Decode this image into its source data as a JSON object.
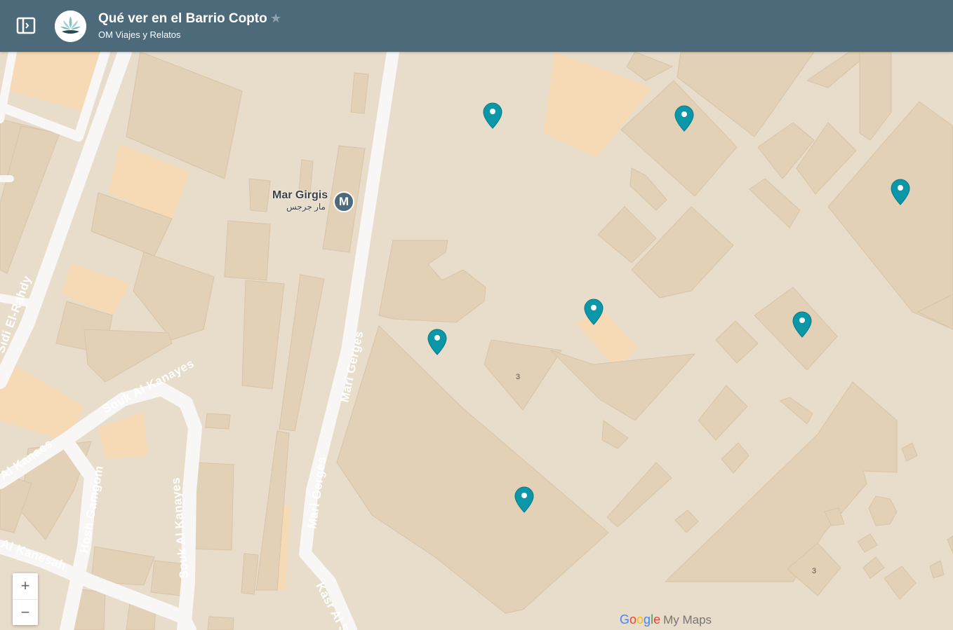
{
  "header": {
    "title": "Qué ver en el Barrio Copto",
    "subtitle": "OM Viajes y Relatos"
  },
  "map": {
    "station": {
      "name": "Mar Girgis",
      "arabic": "مار جرجس",
      "icon": "M"
    },
    "road_labels": [
      "Mari Gerges",
      "Mari Gerges",
      "Souk Al Kanayes",
      "Souk Al Kanayes",
      "Hosh Gamgom",
      "Al Kanaes",
      "Al Kanesah",
      "Sidi El-Rahdy",
      "Kasr Al Sham"
    ],
    "building_numbers": [
      "3",
      "3"
    ],
    "markers": [
      "location-pin-icon",
      "location-pin-icon",
      "location-pin-icon",
      "location-pin-icon",
      "location-pin-icon",
      "location-pin-icon",
      "location-pin-icon"
    ],
    "marker_color": "#0b97a8"
  },
  "controls": {
    "zoom_in": "+",
    "zoom_out": "−"
  },
  "branding": {
    "google": "Google",
    "product": "My Maps"
  },
  "colors": {
    "header": "#4d6a7a",
    "map_bg": "#e8dccb",
    "building": "#e2d1b7",
    "highlight": "#f5dab5",
    "road": "#f8f7f5"
  }
}
